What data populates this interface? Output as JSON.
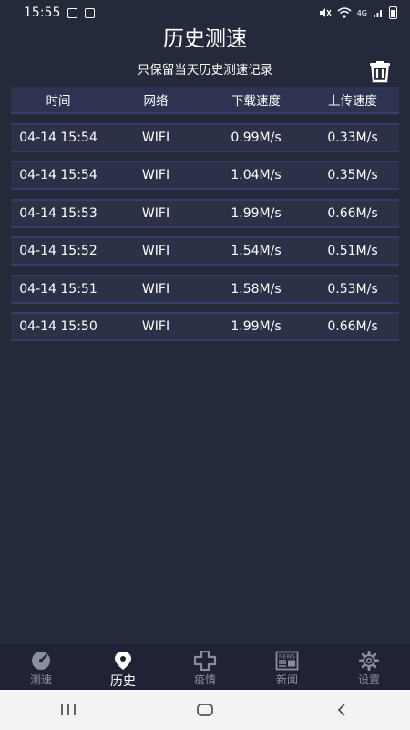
{
  "status_bar": {
    "time": "15:55",
    "network_type": "4G"
  },
  "header": {
    "title": "历史测速",
    "subtitle": "只保留当天历史测速记录"
  },
  "table": {
    "columns": [
      "时间",
      "网络",
      "下载速度",
      "上传速度"
    ],
    "rows": [
      {
        "time": "04-14 15:54",
        "network": "WIFI",
        "download": "0.99M/s",
        "upload": "0.33M/s"
      },
      {
        "time": "04-14 15:54",
        "network": "WIFI",
        "download": "1.04M/s",
        "upload": "0.35M/s"
      },
      {
        "time": "04-14 15:53",
        "network": "WIFI",
        "download": "1.99M/s",
        "upload": "0.66M/s"
      },
      {
        "time": "04-14 15:52",
        "network": "WIFI",
        "download": "1.54M/s",
        "upload": "0.51M/s"
      },
      {
        "time": "04-14 15:51",
        "network": "WIFI",
        "download": "1.58M/s",
        "upload": "0.53M/s"
      },
      {
        "time": "04-14 15:50",
        "network": "WIFI",
        "download": "1.99M/s",
        "upload": "0.66M/s"
      }
    ]
  },
  "bottom_nav": {
    "items": [
      {
        "label": "测速",
        "icon": "speedometer-icon"
      },
      {
        "label": "历史",
        "icon": "location-pin-icon",
        "active": true
      },
      {
        "label": "疫情",
        "icon": "medical-cross-icon"
      },
      {
        "label": "新闻",
        "icon": "newspaper-icon",
        "icon_text": "NEWS"
      },
      {
        "label": "设置",
        "icon": "gear-icon"
      }
    ]
  },
  "colors": {
    "background": "#252a3a",
    "table_row": "#2c3148",
    "nav_background": "#1f2335",
    "nav_active": "#ffffff",
    "nav_inactive": "#8a8f9e"
  }
}
